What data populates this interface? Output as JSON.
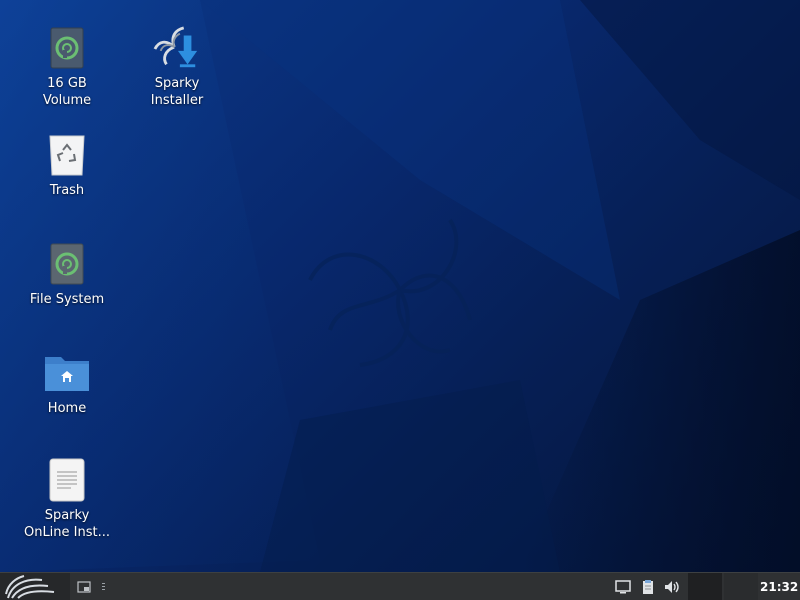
{
  "desktop": {
    "icons": [
      {
        "label": "16 GB\nVolume",
        "icon": "drive-icon"
      },
      {
        "label": "Sparky\nInstaller",
        "icon": "sparky-installer-icon"
      },
      {
        "label": "Trash",
        "icon": "trash-icon"
      },
      {
        "label": "File System",
        "icon": "drive-icon"
      },
      {
        "label": "Home",
        "icon": "home-folder-icon"
      },
      {
        "label": "Sparky\nOnLine Inst...",
        "icon": "document-icon"
      }
    ]
  },
  "taskbar": {
    "clock": "21:32",
    "tray": [
      "display-icon",
      "clipboard-icon",
      "volume-icon"
    ]
  },
  "colors": {
    "taskbar_bg": "#2f3133",
    "desktop_blue": "#0c3a8c",
    "drive_green": "#6bbf73",
    "folder_blue": "#4a90d9"
  }
}
